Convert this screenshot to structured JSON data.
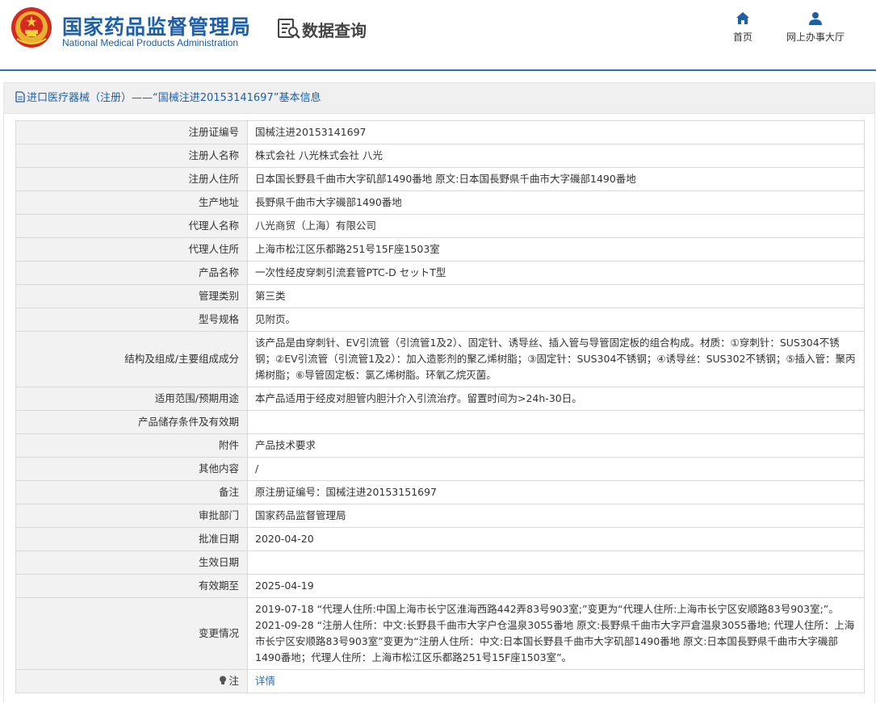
{
  "header": {
    "brand_cn": "国家药品监督管理局",
    "brand_en": "National Medical Products Administration",
    "query_title": "数据查询",
    "nav": [
      {
        "label": "首页",
        "icon": "home-icon"
      },
      {
        "label": "网上办事大厅",
        "icon": "user-icon"
      }
    ]
  },
  "colors": {
    "brand_blue": "#1f5fa6",
    "accent_blue": "#2f6fb0",
    "key_bg": "#f2f2f2",
    "border": "#d9d9d9"
  },
  "breadcrumb": "进口医疗器械（注册）——“国械注进20153141697”基本信息",
  "rows": [
    {
      "label": "注册证编号",
      "value": "国械注进20153141697"
    },
    {
      "label": "注册人名称",
      "value": "株式会社 八光株式会社 八光"
    },
    {
      "label": "注册人住所",
      "value": "日本国长野县千曲市大字矶部1490番地 原文:日本国長野県千曲市大字磯部1490番地"
    },
    {
      "label": "生产地址",
      "value": "長野県千曲市大字磯部1490番地"
    },
    {
      "label": "代理人名称",
      "value": "八光商贸（上海）有限公司"
    },
    {
      "label": "代理人住所",
      "value": "上海市松江区乐都路251号15F座1503室"
    },
    {
      "label": "产品名称",
      "value": "一次性经皮穿刺引流套管PTC-D セットT型"
    },
    {
      "label": "管理类别",
      "value": "第三类"
    },
    {
      "label": "型号规格",
      "value": "见附页。"
    },
    {
      "label": "结构及组成/主要组成成分",
      "value": "该产品是由穿刺针、EV引流管（引流管1及2）、固定针、诱导丝、插入管与导管固定板的组合构成。材质：①穿刺针：SUS304不锈钢；②EV引流管（引流管1及2）：加入造影剂的聚乙烯树脂；③固定针：SUS304不锈钢；④诱导丝：SUS302不锈钢；⑤插入管：聚丙烯树脂；⑥导管固定板：氯乙烯树脂。环氧乙烷灭菌。"
    },
    {
      "label": "适用范围/预期用途",
      "value": "本产品适用于经皮对胆管内胆汁介入引流治疗。留置时间为>24h-30日。"
    },
    {
      "label": "产品储存条件及有效期",
      "value": ""
    },
    {
      "label": "附件",
      "value": "产品技术要求"
    },
    {
      "label": "其他内容",
      "value": "/"
    },
    {
      "label": "备注",
      "value": "原注册证编号：国械注进20153151697"
    },
    {
      "label": "审批部门",
      "value": "国家药品监督管理局"
    },
    {
      "label": "批准日期",
      "value": "2020-04-20"
    },
    {
      "label": "生效日期",
      "value": ""
    },
    {
      "label": "有效期至",
      "value": "2025-04-19"
    },
    {
      "label": "变更情况",
      "value": "2019-07-18 “代理人住所:中国上海市长宁区淮海西路442弄83号903室;”变更为“代理人住所:上海市长宁区安顺路83号903室;”。 2021-09-28 “注册人住所：中文:长野县千曲市大字户仓温泉3055番地 原文:長野県千曲市大字戸倉温泉3055番地; 代理人住所：上海市长宁区安顺路83号903室”变更为“注册人住所：中文:日本国长野县千曲市大字矶部1490番地 原文:日本国長野県千曲市大字磯部1490番地；代理人住所：上海市松江区乐都路251号15F座1503室”。"
    }
  ],
  "note_row": {
    "label": "注",
    "link": "详情",
    "icon": "lightbulb-icon"
  }
}
